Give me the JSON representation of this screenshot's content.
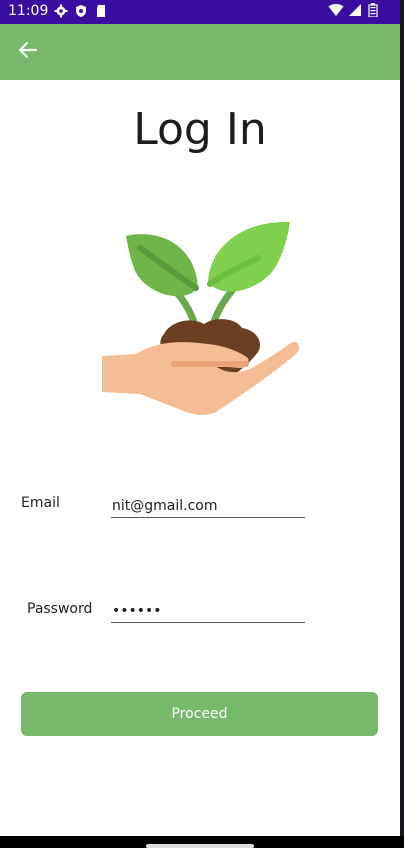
{
  "status_bar": {
    "time": "11:09",
    "left_icons": [
      "settings-icon",
      "shield-icon",
      "sd-card-icon"
    ],
    "right_icons": [
      "wifi-icon",
      "signal-icon",
      "battery-icon"
    ],
    "color": "#3a0ea0"
  },
  "app_bar": {
    "back_icon": "arrow-left-icon",
    "color": "#76b96b"
  },
  "page": {
    "title": "Log In",
    "illustration": "hand-holding-plant"
  },
  "form": {
    "email": {
      "label": "Email",
      "value": "nit@gmail.com"
    },
    "password": {
      "label": "Password",
      "value": "••••••"
    }
  },
  "actions": {
    "proceed_label": "Proceed",
    "accent": "#76b96b"
  }
}
